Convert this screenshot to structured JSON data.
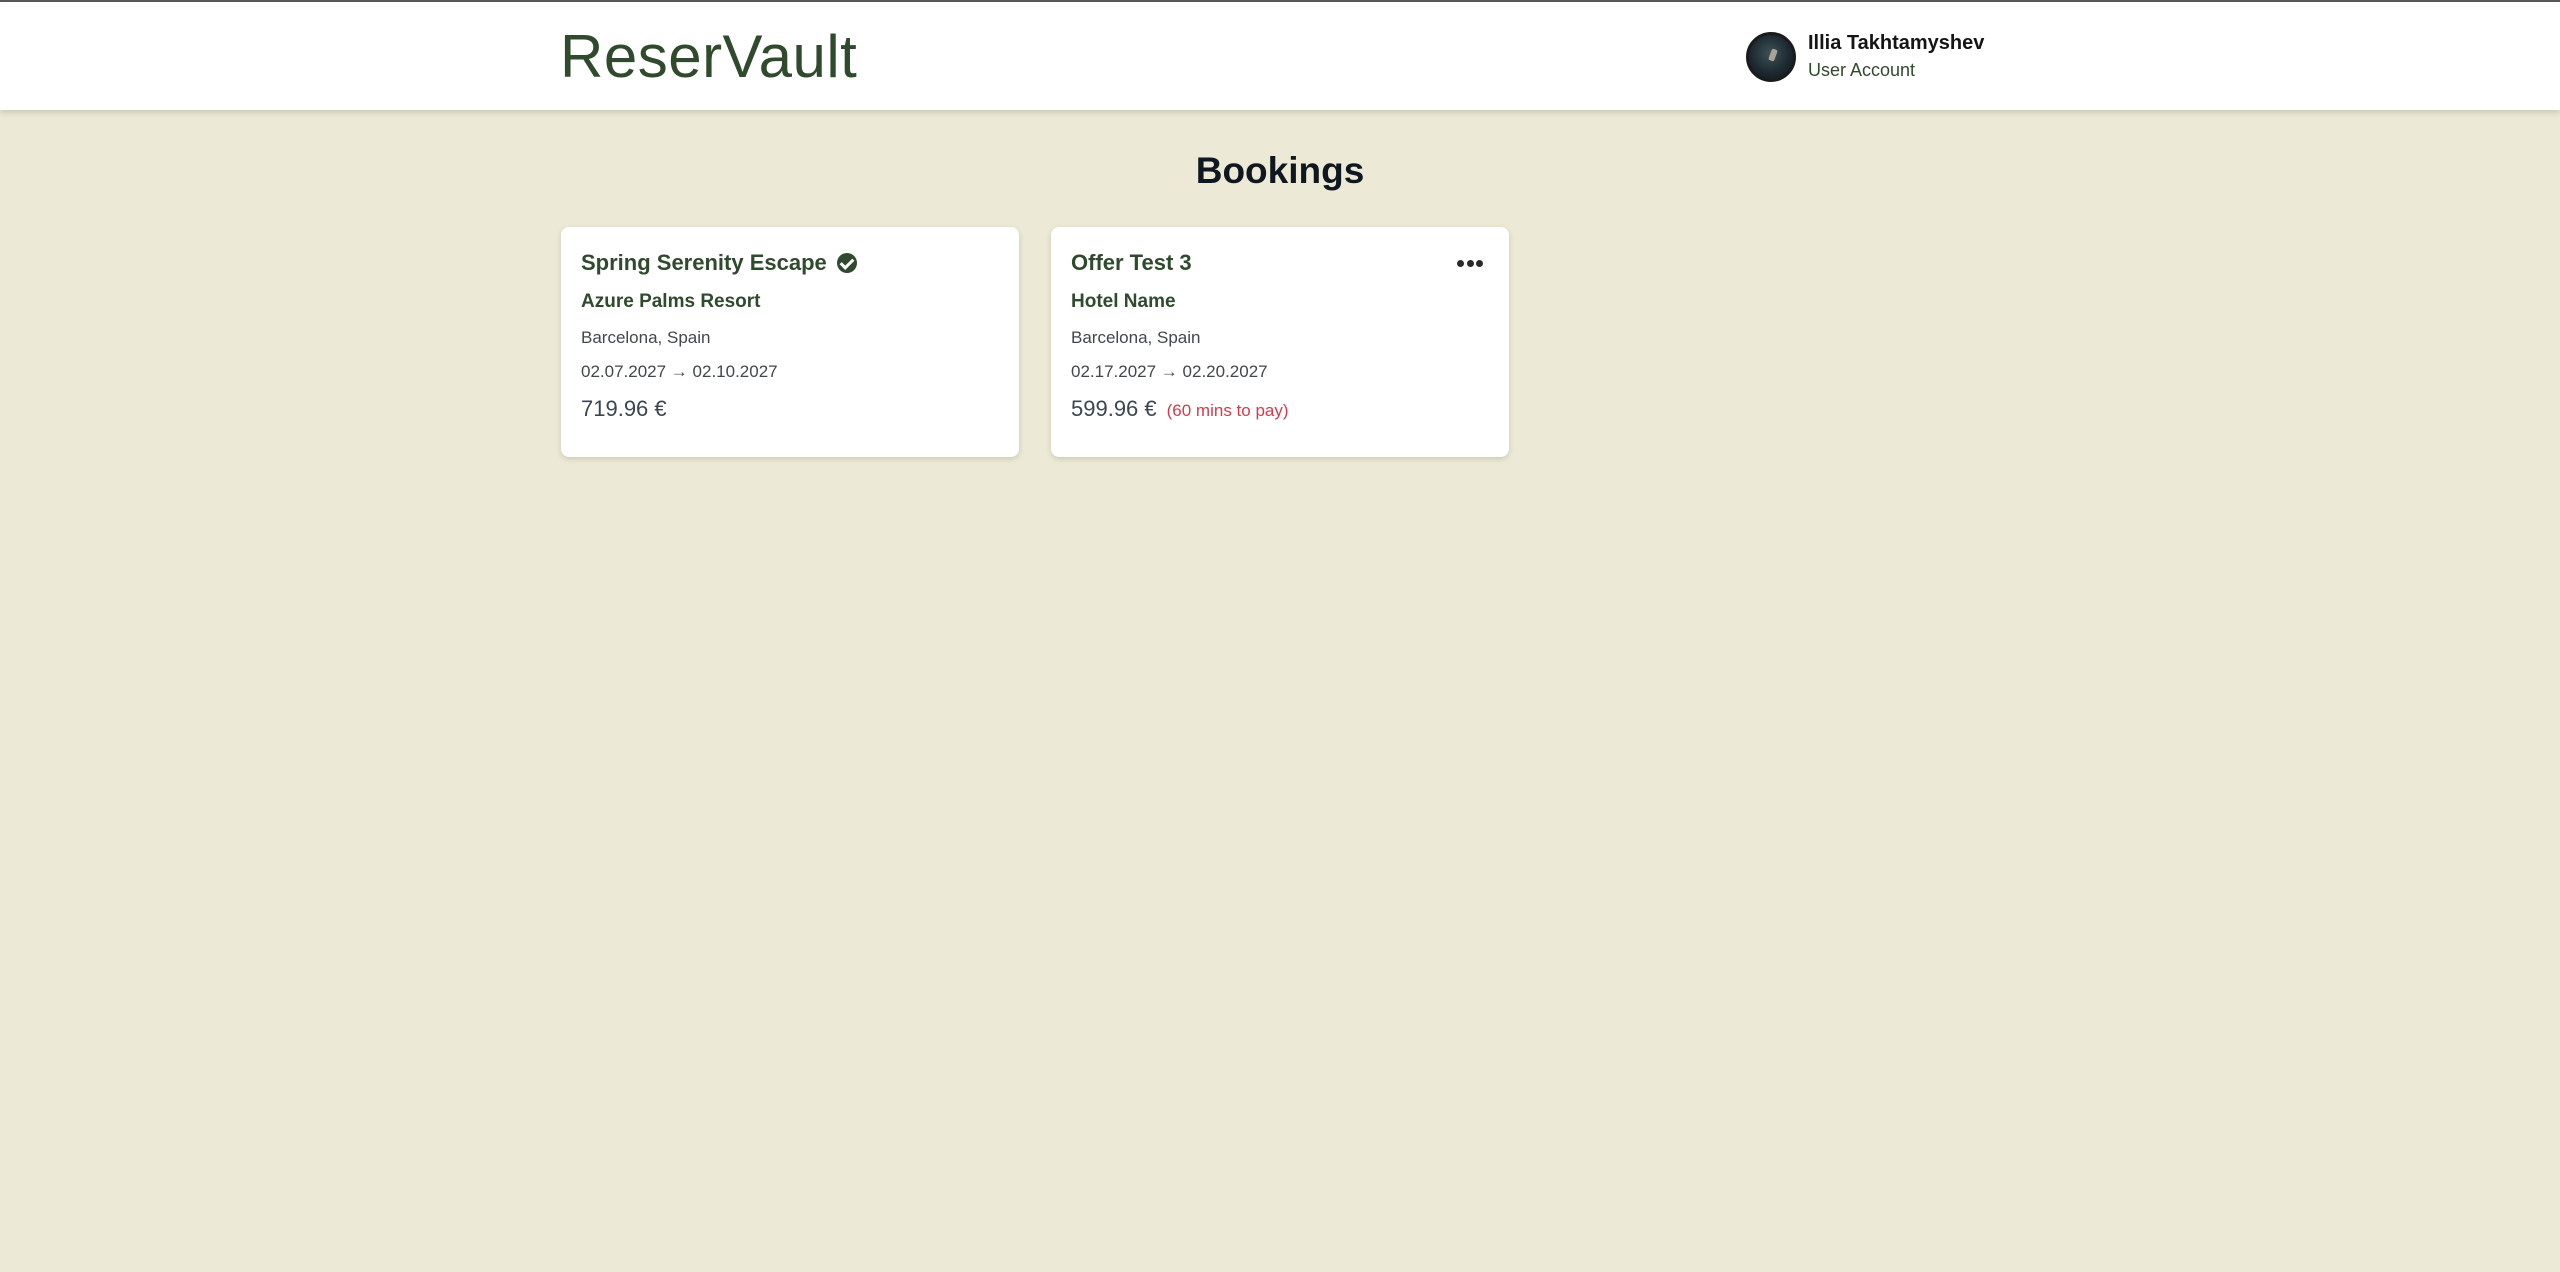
{
  "app": {
    "logo": "ReserVault"
  },
  "user": {
    "name": "Illia Takhtamyshev",
    "role": "User Account"
  },
  "page": {
    "title": "Bookings"
  },
  "bookings": [
    {
      "title": "Spring Serenity Escape",
      "status_icon": "check-circle-icon",
      "hotel": "Azure Palms Resort",
      "location": "Barcelona, Spain",
      "dates": "02.07.2027 → 02.10.2027",
      "price": "719.96 €",
      "note": ""
    },
    {
      "title": "Offer Test 3",
      "menu_icon": "more-horizontal-icon",
      "hotel": "Hotel Name",
      "location": "Barcelona, Spain",
      "dates": "02.17.2027 → 02.20.2027",
      "price": "599.96 €",
      "note": "(60 mins to pay)"
    }
  ],
  "colors": {
    "background": "#ecead6",
    "brand_green": "#2f4a2c",
    "warning_red": "#d8394a",
    "card": "#ffffff"
  }
}
